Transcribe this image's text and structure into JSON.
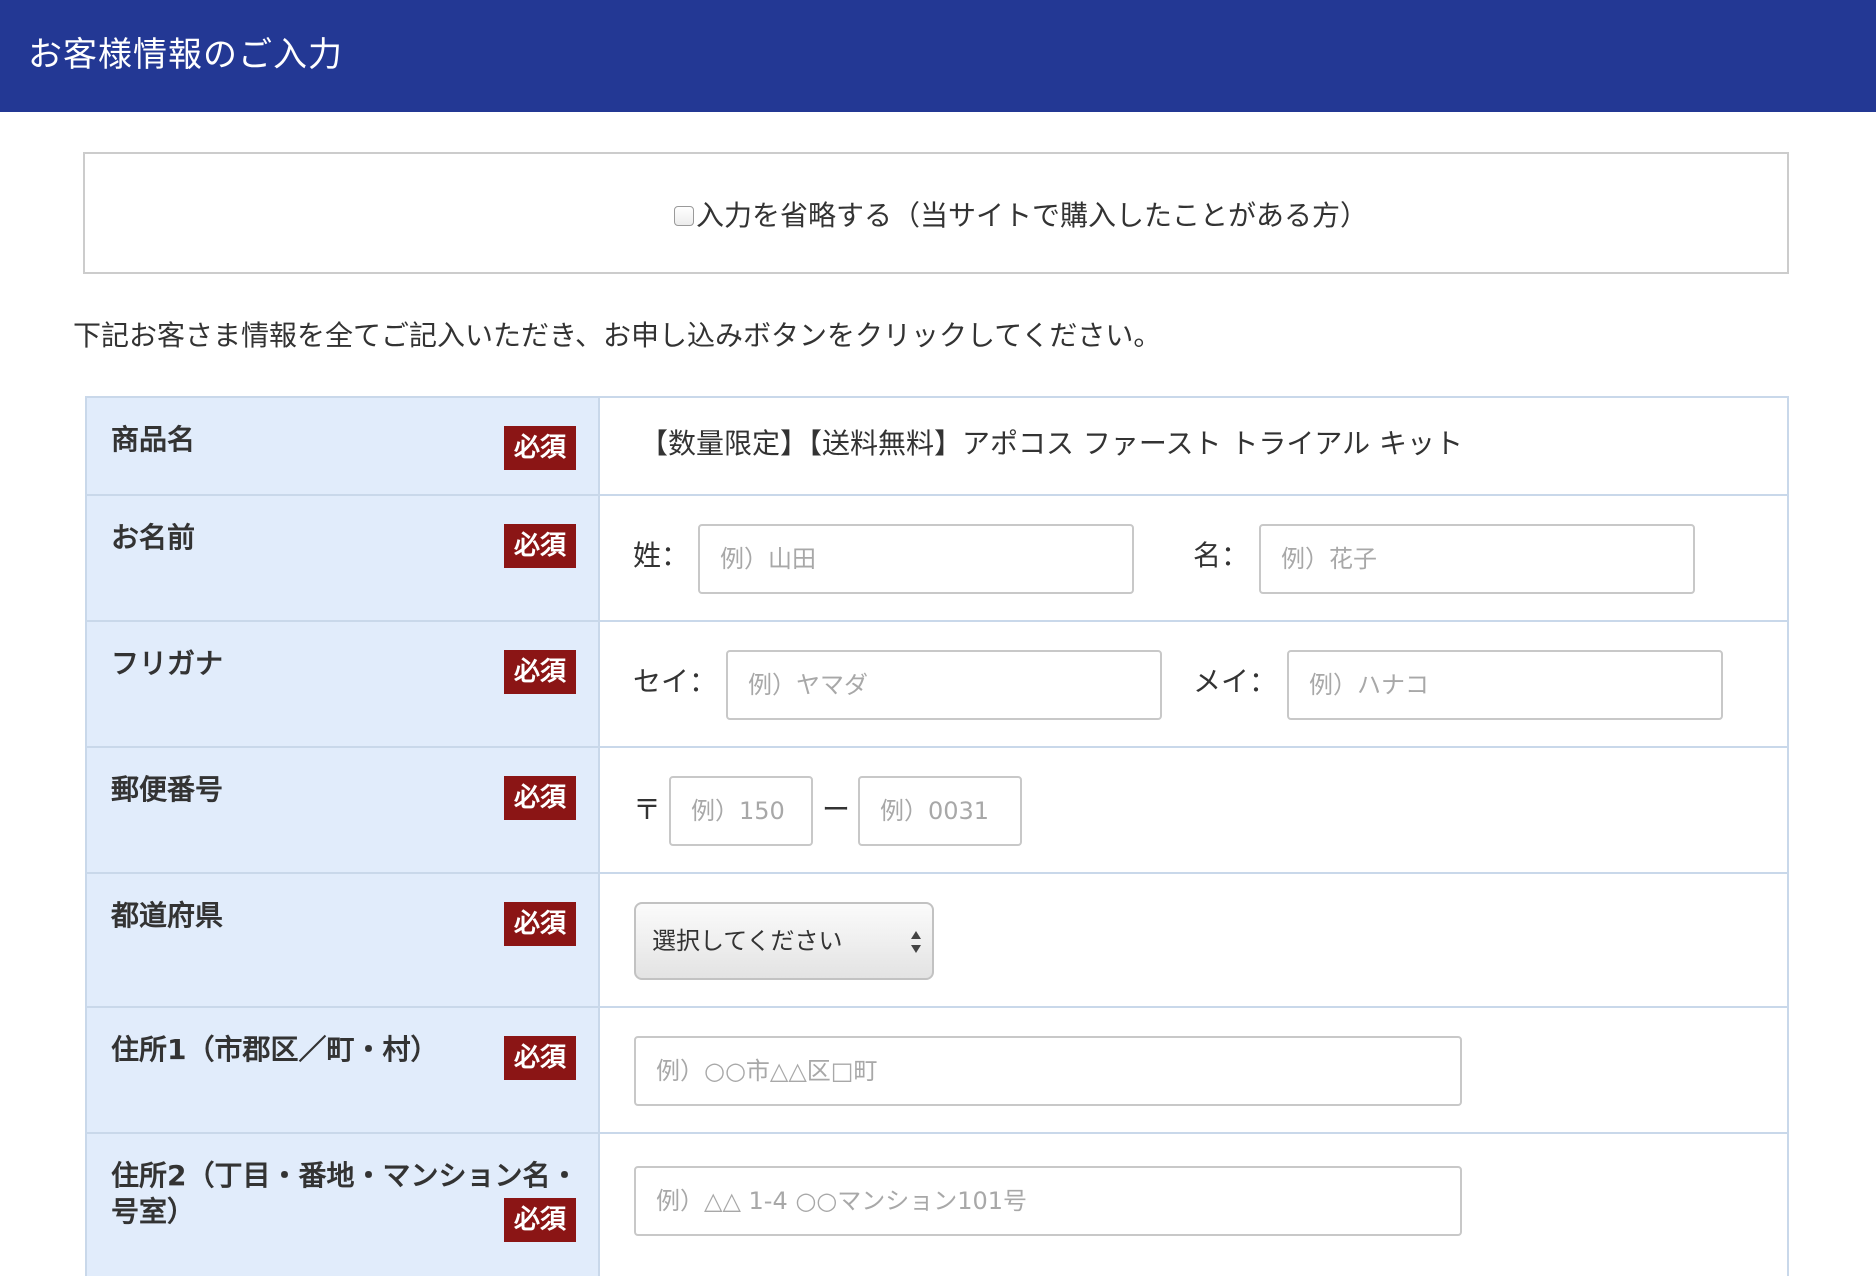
{
  "header": {
    "title": "お客様情報のご入力"
  },
  "skip": {
    "label": "入力を省略する（当サイトで購入したことがある方）"
  },
  "intro": "下記お客さま情報を全てご記入いただき、お申し込みボタンをクリックしてください。",
  "required_label": "必須",
  "fields": {
    "product": {
      "label": "商品名",
      "value": "【数量限定】【送料無料】アポコス ファースト トライアル キット"
    },
    "name": {
      "label": "お名前",
      "last_label": "姓：",
      "last_placeholder": "例）山田",
      "first_label": "名：",
      "first_placeholder": "例）花子"
    },
    "kana": {
      "label": "フリガナ",
      "last_label": "セイ：",
      "last_placeholder": "例）ヤマダ",
      "first_label": "メイ：",
      "first_placeholder": "例）ハナコ"
    },
    "postal": {
      "label": "郵便番号",
      "prefix": "〒",
      "first_placeholder": "例）150",
      "separator": "ー",
      "second_placeholder": "例）0031"
    },
    "prefecture": {
      "label": "都道府県",
      "selected": "選択してください"
    },
    "address1": {
      "label": "住所1（市郡区／町・村）",
      "placeholder": "例）○○市△△区□町"
    },
    "address2": {
      "label_line1": "住所2（丁目・番地・マンション名・",
      "label_line2": "号室）",
      "placeholder": "例）△△ 1-4 ○○マンション101号"
    }
  }
}
